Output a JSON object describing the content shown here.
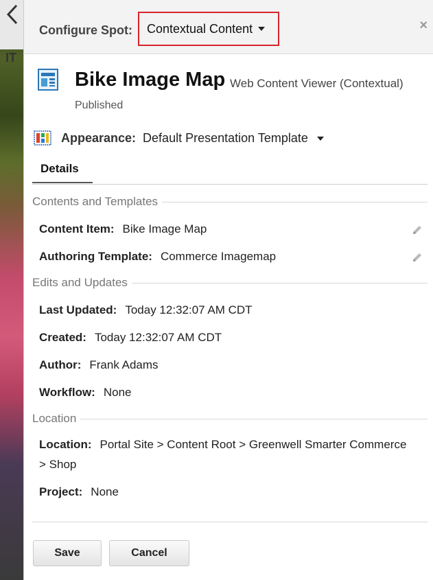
{
  "background": {
    "partial_text": "IT"
  },
  "header": {
    "configure_label": "Configure Spot:",
    "spot_selected": "Contextual Content",
    "close_glyph": "×"
  },
  "content": {
    "title": "Bike Image Map",
    "type": "Web Content Viewer (Contextual)",
    "status": "Published"
  },
  "appearance": {
    "label": "Appearance:",
    "value": "Default Presentation Template"
  },
  "tabs": [
    {
      "label": "Details",
      "active": true
    }
  ],
  "sections": {
    "contents_templates": {
      "title": "Contents and Templates",
      "content_item_label": "Content Item:",
      "content_item_value": "Bike Image Map",
      "authoring_template_label": "Authoring Template:",
      "authoring_template_value": "Commerce Imagemap"
    },
    "edits_updates": {
      "title": "Edits and Updates",
      "last_updated_label": "Last Updated:",
      "last_updated_value": "Today 12:32:07 AM CDT",
      "created_label": "Created:",
      "created_value": "Today 12:32:07 AM CDT",
      "author_label": "Author:",
      "author_value": "Frank Adams",
      "workflow_label": "Workflow:",
      "workflow_value": "None"
    },
    "location": {
      "title": "Location",
      "location_label": "Location:",
      "location_value": "Portal Site > Content Root > Greenwell Smarter Commerce > Shop",
      "project_label": "Project:",
      "project_value": "None"
    }
  },
  "buttons": {
    "save": "Save",
    "cancel": "Cancel"
  },
  "colors": {
    "highlight_border": "#d9232b",
    "header_bg": "#f3f3f3"
  },
  "icons": [
    "chevron-left-icon",
    "close-icon",
    "web-content-icon",
    "appearance-template-icon",
    "pencil-icon"
  ]
}
